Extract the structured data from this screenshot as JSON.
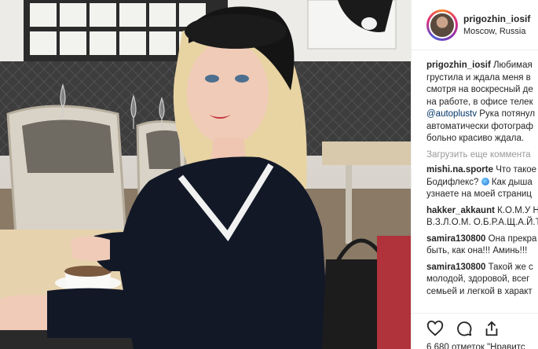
{
  "post": {
    "username": "prigozhin_iosif",
    "location": "Moscow, Russia"
  },
  "caption": {
    "user": "prigozhin_iosif",
    "lines": [
      "Любимая",
      "грустила и ждала меня в",
      "смотря на воскресный де",
      "на работе, в офисе телек"
    ],
    "mention": "@autoplustv",
    "mention_rest": " Рука потянул",
    "lines_after": [
      "автоматически фотограф",
      "больно красиво ждала."
    ]
  },
  "load_more": "Загрузить еще коммента",
  "comments": [
    {
      "user": "mishi.na.sporte",
      "text": "Что такое",
      "lines": [
        "Бодифлекс?",
        "узнаете на моей страниц"
      ],
      "line2_rest": " Как дыша"
    },
    {
      "user": "hakker_akkaunt",
      "text": "К.О.М.У Н",
      "lines": [
        "В.З.Л.О.М. О.Б.Р.А.Щ.А.Й.Т"
      ]
    },
    {
      "user": "samira130800",
      "text": "Она прекра",
      "lines": [
        "быть, как она!!! Аминь!!!"
      ]
    },
    {
      "user": "samira130800",
      "text": "Такой же с",
      "lines": [
        "молодой, здоровой, всег",
        "семьей и легкой в характ"
      ]
    }
  ],
  "actions": {
    "like_icon": "heart-icon",
    "comment_icon": "comment-icon",
    "share_icon": "share-icon"
  },
  "likes_text": "6 680 отметок \"Нравитс",
  "colors": {
    "link": "#003569",
    "muted": "#999999",
    "text": "#262626"
  }
}
